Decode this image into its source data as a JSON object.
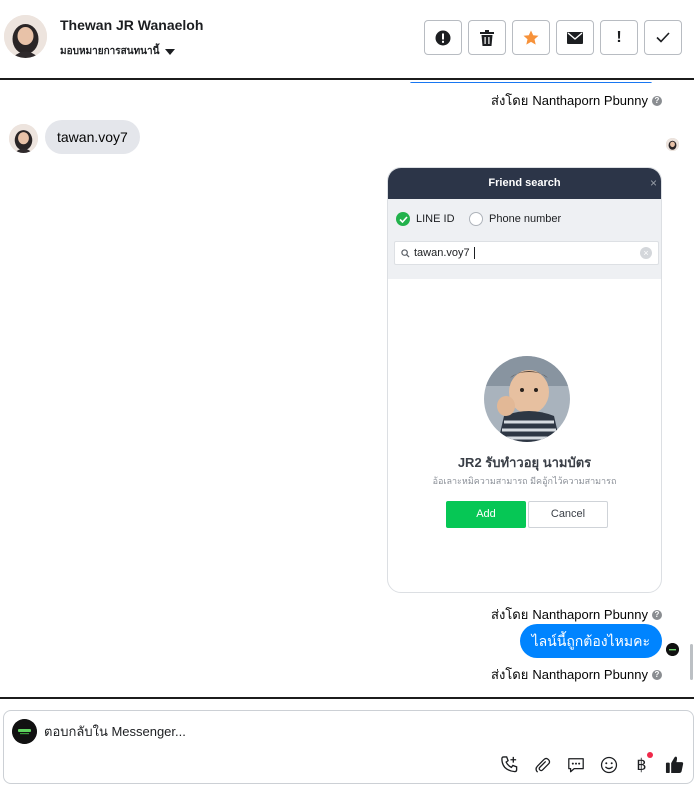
{
  "header": {
    "contact_name": "Thewan JR Wanaeloh",
    "assign_label": "มอบหมายการสนทนานี้",
    "buttons": [
      {
        "name": "mark-spam",
        "icon": "alert-circle-icon"
      },
      {
        "name": "delete",
        "icon": "trash-icon"
      },
      {
        "name": "star",
        "icon": "star-icon"
      },
      {
        "name": "mark-unread",
        "icon": "envelope-icon"
      },
      {
        "name": "follow-up",
        "icon": "exclamation-icon"
      },
      {
        "name": "done",
        "icon": "check-icon"
      }
    ]
  },
  "conversation": {
    "sent_by_prefix": "ส่งโดย",
    "sender": "Nanthaporn Pbunny",
    "customer_message": "tawan.voy7",
    "my_message": "ไลน์นี้ถูกต้องไหมคะ",
    "shared_image": {
      "title": "Friend search",
      "close": "×",
      "option_line_id": "LINE ID",
      "option_phone": "Phone number",
      "search_value": "tawan.voy7",
      "profile_name": "JR2 รับทำวอยุ นามบัตร",
      "profile_desc": "อ้อเลาะหมิความสามารถ มีคอู้กไว้ความสามารถ",
      "add_label": "Add",
      "cancel_label": "Cancel"
    }
  },
  "composer": {
    "placeholder": "ตอบกลับใน Messenger...",
    "tools": [
      "call-add-icon",
      "paperclip-icon",
      "saved-reply-icon",
      "emoji-icon",
      "baht-icon",
      "thumbs-up-icon"
    ],
    "baht_symbol": "฿"
  },
  "colors": {
    "accent_blue": "#0084ff",
    "line_green": "#06c755",
    "star_orange": "#f7923a"
  }
}
